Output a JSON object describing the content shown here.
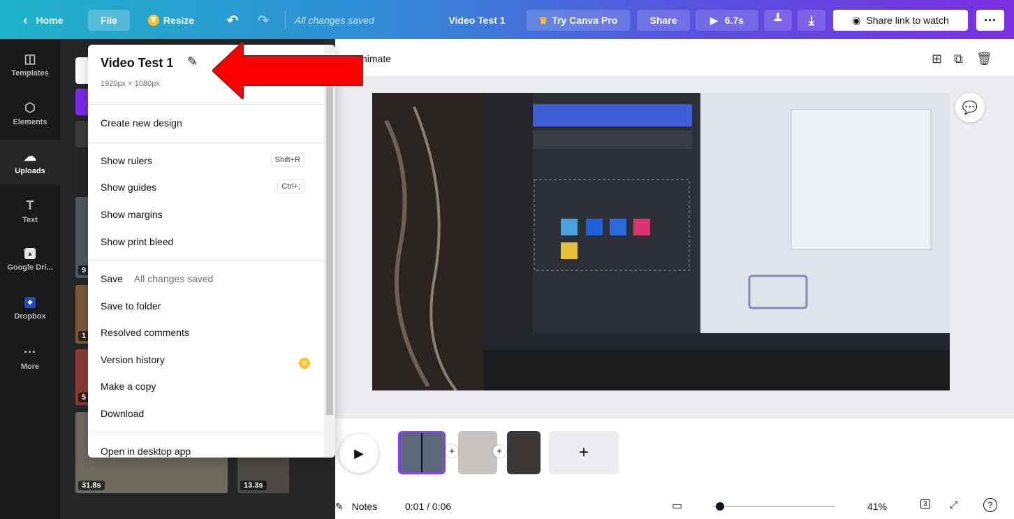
{
  "topbar": {
    "home": "Home",
    "file": "File",
    "resize": "Resize",
    "saved_status": "All changes saved",
    "design_title": "Video Test 1",
    "try_pro": "Try Canva Pro",
    "share": "Share",
    "duration": "6.7s",
    "share_link": "Share link to watch"
  },
  "rail": {
    "items": [
      {
        "label": "Templates",
        "icon": "templates-icon"
      },
      {
        "label": "Elements",
        "icon": "elements-icon"
      },
      {
        "label": "Uploads",
        "icon": "uploads-icon"
      },
      {
        "label": "Text",
        "icon": "text-icon"
      },
      {
        "label": "Google Dri...",
        "icon": "google-drive-icon"
      },
      {
        "label": "Dropbox",
        "icon": "dropbox-icon"
      },
      {
        "label": "More",
        "icon": "more-icon"
      }
    ]
  },
  "panel": {
    "thumb_badges": [
      "9",
      "1",
      "5",
      "31.8s",
      "13.3s"
    ]
  },
  "file_menu": {
    "title": "Video Test 1",
    "dimensions": "1920px × 1080px",
    "create_new": "Create new design",
    "show_rulers": "Show rulers",
    "show_rulers_kbd": "Shift+R",
    "show_guides": "Show guides",
    "show_guides_kbd": "Ctrl+;",
    "show_margins": "Show margins",
    "show_print_bleed": "Show print bleed",
    "save": "Save",
    "save_status": "All changes saved",
    "save_to_folder": "Save to folder",
    "resolved_comments": "Resolved comments",
    "version_history": "Version history",
    "make_copy": "Make a copy",
    "download": "Download",
    "open_desktop": "Open in desktop app"
  },
  "editor": {
    "animate": "nimate"
  },
  "bottombar": {
    "notes": "Notes",
    "time": "0:01 / 0:06",
    "zoom": "41%",
    "page_count": "3"
  },
  "colors": {
    "accent": "#8b3dff",
    "rail_bg": "#18191b",
    "panel_bg": "#252627",
    "annotation_arrow": "#ff0000"
  }
}
